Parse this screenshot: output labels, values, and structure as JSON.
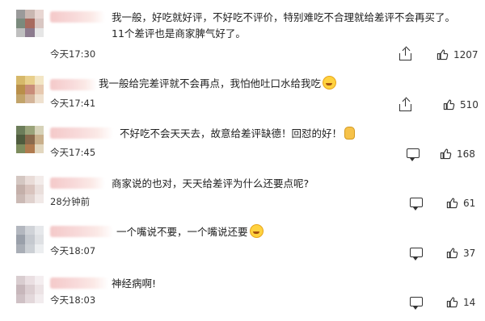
{
  "comments": [
    {
      "text": "我一般，好吃就好评，不好吃不评价，特别难吃不合理就给差评不会再买了。11个差评也是商家脾气好了。",
      "time": "今天17:30",
      "likes": "1207",
      "emoji": "",
      "avatar": [
        "#9a9a9a",
        "#c9b7b1",
        "#e8d6d2",
        "#7b8a7d",
        "#a86b5f",
        "#d9c7c3",
        "#bfbfbf",
        "#8c7b8e",
        "#e6e6e6"
      ]
    },
    {
      "text": "我一般给完差评就不会再点，我怕他吐口水给我吃",
      "time": "今天17:41",
      "likes": "510",
      "emoji": "laughing-emoji",
      "avatar": [
        "#d6b86a",
        "#e8cf8c",
        "#f3e6c5",
        "#b98f4a",
        "#c98d7a",
        "#e7c9b0",
        "#c2a46a",
        "#d4b59a",
        "#efe1cf"
      ]
    },
    {
      "text": "不好吃不会天天去，故意给差评缺德！回怼的好！",
      "time": "今天17:45",
      "likes": "168",
      "emoji": "hand",
      "avatar": [
        "#6c7d5a",
        "#9aa37a",
        "#d6d2b8",
        "#4f5c3e",
        "#8a6a4d",
        "#c9b08c",
        "#7d8c5d",
        "#b07b4f",
        "#e2d7bf"
      ]
    },
    {
      "text": "商家说的也对，天天给差评为什么还要点呢?",
      "time": "28分钟前",
      "likes": "61",
      "emoji": "",
      "avatar": [
        "#d4c7c2",
        "#e9dcd8",
        "#f3ecea",
        "#c4b0aa",
        "#d9c4be",
        "#eadfdc",
        "#cbbab5",
        "#e0d2ce",
        "#f1e9e7"
      ]
    },
    {
      "text": "一个嘴说不要，一个嘴说还要",
      "time": "今天18:07",
      "likes": "37",
      "emoji": "laughing-emoji",
      "avatar": [
        "#b3b7bf",
        "#d0d3d8",
        "#e6e8eb",
        "#9aa0aa",
        "#c5c9cf",
        "#dfe1e4",
        "#a9aeb6",
        "#ccd0d5",
        "#eceef0"
      ]
    },
    {
      "text": "神经病啊!",
      "time": "今天18:03",
      "likes": "14",
      "emoji": "",
      "avatar": [
        "#d9cdd0",
        "#eadfe2",
        "#f4eef0",
        "#c7b7bb",
        "#dccfd2",
        "#ece3e5",
        "#cfc1c5",
        "#e3d8db",
        "#f2ecee"
      ]
    }
  ]
}
